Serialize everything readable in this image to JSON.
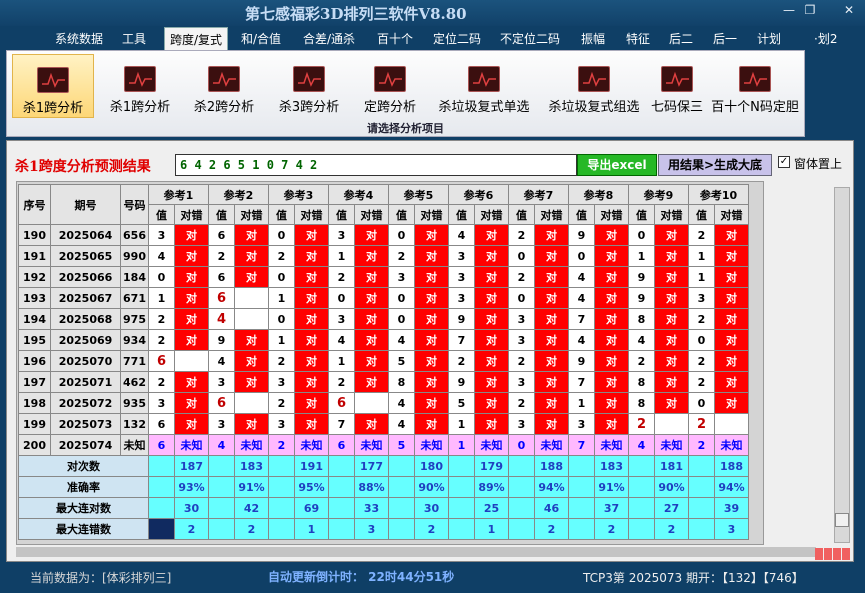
{
  "window": {
    "title": "第七感福彩3D排列三软件V8.80",
    "minimize": "—",
    "restore": "❐",
    "close": "✕"
  },
  "menu": [
    "系统数据",
    "工具",
    "跨度/复式",
    "和/合值",
    "合差/通杀",
    "百十个",
    "定位二码",
    "不定位二码",
    "振幅",
    "特征",
    "后二",
    "后一",
    "计划",
    "·划2"
  ],
  "menu_active": 2,
  "ribbon": {
    "buttons": [
      "杀1跨分析",
      "杀1跨分析",
      "杀2跨分析",
      "杀3跨分析",
      "定跨分析",
      "杀垃圾复式单选",
      "杀垃圾复式组选",
      "七码保三",
      "百十个N码定胆"
    ],
    "selected": 0,
    "caption": "请选择分析项目"
  },
  "result": {
    "label": "杀1跨度分析预测结果",
    "value": "6 4 2 6 5 1 0 7 4 2",
    "excel_btn": "导出excel",
    "gen_btn": "用结果>生成大底",
    "checkbox": "窗体置上",
    "checked": "✓"
  },
  "table": {
    "head": {
      "seq": "序号",
      "period": "期号",
      "num": "号码",
      "ref_prefix": "参考",
      "val": "值",
      "cmp": "对错"
    },
    "rows": [
      {
        "seq": "190",
        "period": "2025064",
        "num": "656",
        "cells": [
          [
            "3",
            "对"
          ],
          [
            "6",
            "对"
          ],
          [
            "0",
            "对"
          ],
          [
            "3",
            "对"
          ],
          [
            "0",
            "对"
          ],
          [
            "4",
            "对"
          ],
          [
            "2",
            "对"
          ],
          [
            "9",
            "对"
          ],
          [
            "0",
            "对"
          ],
          [
            "2",
            "对"
          ]
        ]
      },
      {
        "seq": "191",
        "period": "2025065",
        "num": "990",
        "cells": [
          [
            "4",
            "对"
          ],
          [
            "2",
            "对"
          ],
          [
            "2",
            "对"
          ],
          [
            "1",
            "对"
          ],
          [
            "2",
            "对"
          ],
          [
            "3",
            "对"
          ],
          [
            "0",
            "对"
          ],
          [
            "0",
            "对"
          ],
          [
            "1",
            "对"
          ],
          [
            "1",
            "对"
          ]
        ]
      },
      {
        "seq": "192",
        "period": "2025066",
        "num": "184",
        "cells": [
          [
            "0",
            "对"
          ],
          [
            "6",
            "对"
          ],
          [
            "0",
            "对"
          ],
          [
            "2",
            "对"
          ],
          [
            "3",
            "对"
          ],
          [
            "3",
            "对"
          ],
          [
            "2",
            "对"
          ],
          [
            "4",
            "对"
          ],
          [
            "9",
            "对"
          ],
          [
            "1",
            "对"
          ]
        ]
      },
      {
        "seq": "193",
        "period": "2025067",
        "num": "671",
        "cells": [
          [
            "1",
            "对"
          ],
          [
            "6",
            ""
          ],
          [
            "1",
            "对"
          ],
          [
            "0",
            "对"
          ],
          [
            "0",
            "对"
          ],
          [
            "3",
            "对"
          ],
          [
            "0",
            "对"
          ],
          [
            "4",
            "对"
          ],
          [
            "9",
            "对"
          ],
          [
            "3",
            "对"
          ]
        ]
      },
      {
        "seq": "194",
        "period": "2025068",
        "num": "975",
        "cells": [
          [
            "2",
            "对"
          ],
          [
            "4",
            ""
          ],
          [
            "0",
            "对"
          ],
          [
            "3",
            "对"
          ],
          [
            "0",
            "对"
          ],
          [
            "9",
            "对"
          ],
          [
            "3",
            "对"
          ],
          [
            "7",
            "对"
          ],
          [
            "8",
            "对"
          ],
          [
            "2",
            "对"
          ]
        ]
      },
      {
        "seq": "195",
        "period": "2025069",
        "num": "934",
        "cells": [
          [
            "2",
            "对"
          ],
          [
            "9",
            "对"
          ],
          [
            "1",
            "对"
          ],
          [
            "4",
            "对"
          ],
          [
            "4",
            "对"
          ],
          [
            "7",
            "对"
          ],
          [
            "3",
            "对"
          ],
          [
            "4",
            "对"
          ],
          [
            "4",
            "对"
          ],
          [
            "0",
            "对"
          ]
        ]
      },
      {
        "seq": "196",
        "period": "2025070",
        "num": "771",
        "cells": [
          [
            "6",
            ""
          ],
          [
            "4",
            "对"
          ],
          [
            "2",
            "对"
          ],
          [
            "1",
            "对"
          ],
          [
            "5",
            "对"
          ],
          [
            "2",
            "对"
          ],
          [
            "2",
            "对"
          ],
          [
            "9",
            "对"
          ],
          [
            "2",
            "对"
          ],
          [
            "2",
            "对"
          ]
        ]
      },
      {
        "seq": "197",
        "period": "2025071",
        "num": "462",
        "cells": [
          [
            "2",
            "对"
          ],
          [
            "3",
            "对"
          ],
          [
            "3",
            "对"
          ],
          [
            "2",
            "对"
          ],
          [
            "8",
            "对"
          ],
          [
            "9",
            "对"
          ],
          [
            "3",
            "对"
          ],
          [
            "7",
            "对"
          ],
          [
            "8",
            "对"
          ],
          [
            "2",
            "对"
          ]
        ]
      },
      {
        "seq": "198",
        "period": "2025072",
        "num": "935",
        "cells": [
          [
            "3",
            "对"
          ],
          [
            "6",
            ""
          ],
          [
            "2",
            "对"
          ],
          [
            "6",
            ""
          ],
          [
            "4",
            "对"
          ],
          [
            "5",
            "对"
          ],
          [
            "2",
            "对"
          ],
          [
            "1",
            "对"
          ],
          [
            "8",
            "对"
          ],
          [
            "0",
            "对"
          ]
        ]
      },
      {
        "seq": "199",
        "period": "2025073",
        "num": "132",
        "cells": [
          [
            "6",
            "对"
          ],
          [
            "3",
            "对"
          ],
          [
            "3",
            "对"
          ],
          [
            "7",
            "对"
          ],
          [
            "4",
            "对"
          ],
          [
            "1",
            "对"
          ],
          [
            "3",
            "对"
          ],
          [
            "3",
            "对"
          ],
          [
            "2",
            ""
          ],
          [
            "2",
            ""
          ]
        ]
      }
    ],
    "pred": {
      "seq": "200",
      "period": "2025074",
      "num": "未知",
      "cells": [
        [
          "6",
          "未知"
        ],
        [
          "4",
          "未知"
        ],
        [
          "2",
          "未知"
        ],
        [
          "6",
          "未知"
        ],
        [
          "5",
          "未知"
        ],
        [
          "1",
          "未知"
        ],
        [
          "0",
          "未知"
        ],
        [
          "7",
          "未知"
        ],
        [
          "4",
          "未知"
        ],
        [
          "2",
          "未知"
        ]
      ]
    },
    "stats": [
      {
        "label": "对次数",
        "values": [
          "187",
          "183",
          "191",
          "177",
          "180",
          "179",
          "188",
          "183",
          "181",
          "188"
        ]
      },
      {
        "label": "准确率",
        "values": [
          "93%",
          "91%",
          "95%",
          "88%",
          "90%",
          "89%",
          "94%",
          "91%",
          "90%",
          "94%"
        ]
      },
      {
        "label": "最大连对数",
        "values": [
          "30",
          "42",
          "69",
          "33",
          "30",
          "25",
          "46",
          "37",
          "27",
          "39"
        ]
      },
      {
        "label": "最大连错数",
        "values": [
          "2",
          "2",
          "1",
          "3",
          "2",
          "1",
          "2",
          "2",
          "2",
          "3"
        ]
      }
    ]
  },
  "status": {
    "current": "当前数据为：[体彩排列三]",
    "countdown": "自动更新倒计时： 22时44分51秒",
    "tcp": "TCP3第 2025073 期开：【132】【746】"
  },
  "colors": {
    "hit": "#ff0000",
    "pred": "#ffb9ff",
    "stat": "#66ffff",
    "bg": "#0f3f66"
  }
}
